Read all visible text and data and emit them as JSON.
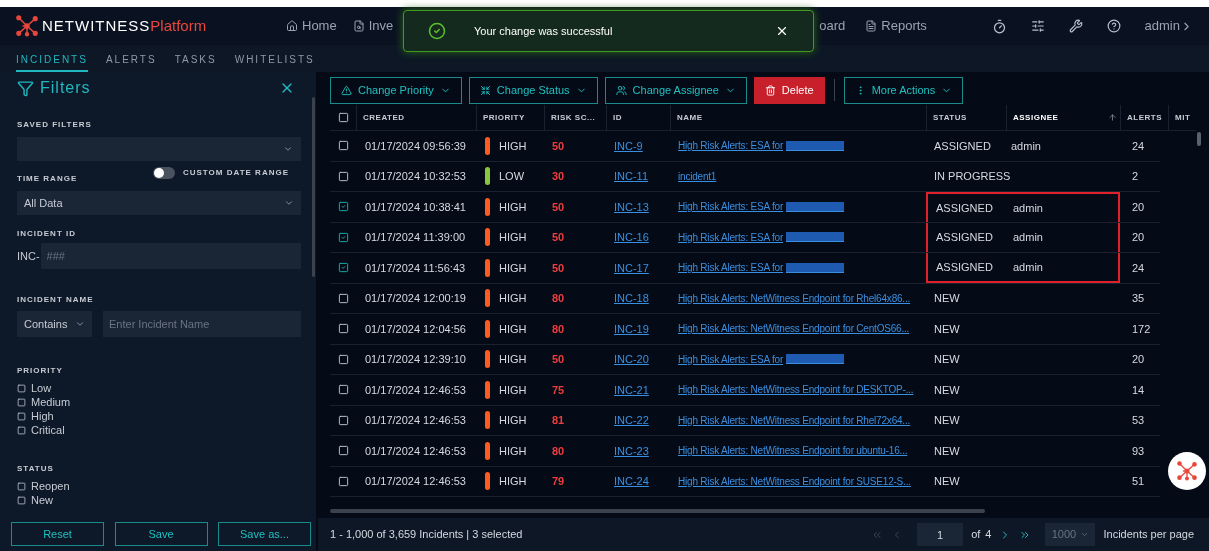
{
  "header": {
    "logo_text": "NETWITNESS",
    "logo_accent": "Platform",
    "nav": [
      {
        "label": "Home"
      },
      {
        "label": "Inve"
      },
      {
        "label": "oard"
      },
      {
        "label": "Reports"
      }
    ],
    "user": "admin"
  },
  "toast": {
    "message": "Your change was successful"
  },
  "tabs": [
    {
      "label": "INCIDENTS",
      "selected": true
    },
    {
      "label": "ALERTS",
      "selected": false
    },
    {
      "label": "TASKS",
      "selected": false
    },
    {
      "label": "WHITELISTS",
      "selected": false
    }
  ],
  "filters": {
    "title": "Filters",
    "saved_filters_label": "SAVED FILTERS",
    "custom_date_range": {
      "label": "CUSTOM DATE RANGE",
      "on": false
    },
    "time_range": {
      "label": "TIME RANGE",
      "value": "All Data"
    },
    "incident_id": {
      "label": "INCIDENT ID",
      "prefix": "INC-",
      "placeholder": "###"
    },
    "incident_name": {
      "label": "INCIDENT NAME",
      "operator": "Contains",
      "placeholder": "Enter Incident Name"
    },
    "priority": {
      "label": "PRIORITY",
      "options": [
        {
          "label": "Low",
          "checked": false
        },
        {
          "label": "Medium",
          "checked": false
        },
        {
          "label": "High",
          "checked": false
        },
        {
          "label": "Critical",
          "checked": false
        }
      ]
    },
    "status": {
      "label": "STATUS",
      "options": [
        {
          "label": "Reopen",
          "checked": false
        },
        {
          "label": "New",
          "checked": false
        }
      ]
    },
    "buttons": [
      "Reset",
      "Save",
      "Save as..."
    ]
  },
  "toolbar": [
    {
      "label": "Change Priority",
      "kind": "menu"
    },
    {
      "label": "Change Status",
      "kind": "menu"
    },
    {
      "label": "Change Assignee",
      "kind": "menu"
    },
    {
      "label": "Delete",
      "kind": "danger"
    },
    {
      "label": "More Actions",
      "kind": "more"
    }
  ],
  "table": {
    "select_all_checked": false,
    "columns": [
      {
        "label": "CREATED",
        "sorted": false
      },
      {
        "label": "PRIORITY",
        "sorted": false
      },
      {
        "label": "RISK SC...",
        "sorted": false
      },
      {
        "label": "ID",
        "sorted": false
      },
      {
        "label": "NAME",
        "sorted": false
      },
      {
        "label": "STATUS",
        "sorted": false
      },
      {
        "label": "ASSIGNEE",
        "sorted": true
      },
      {
        "label": "ALERTS",
        "sorted": false
      },
      {
        "label": "MIT",
        "sorted": false
      }
    ],
    "rows": [
      {
        "checked": false,
        "created": "01/17/2024 09:56:39",
        "priority": "HIGH",
        "color": "#ff5a1f",
        "risk": "50",
        "id": "INC-9",
        "name": "High Risk Alerts: ESA for",
        "redacted": true,
        "status": "ASSIGNED",
        "assignee": "admin",
        "alerts": "24",
        "highlighted": false
      },
      {
        "checked": false,
        "created": "01/17/2024 10:32:53",
        "priority": "LOW",
        "color": "#8cc63f",
        "risk": "30",
        "id": "INC-11",
        "name": "incident1",
        "redacted": false,
        "status": "IN PROGRESS",
        "alerts": "2",
        "highlighted": false
      },
      {
        "checked": true,
        "created": "01/17/2024 10:38:41",
        "priority": "HIGH",
        "color": "#ff5a1f",
        "risk": "50",
        "id": "INC-13",
        "name": "High Risk Alerts: ESA for",
        "redacted": true,
        "status": "ASSIGNED",
        "assignee": "admin",
        "alerts": "20",
        "highlighted": true
      },
      {
        "checked": true,
        "created": "01/17/2024 11:39:00",
        "priority": "HIGH",
        "color": "#ff5a1f",
        "risk": "50",
        "id": "INC-16",
        "name": "High Risk Alerts: ESA for",
        "redacted": true,
        "status": "ASSIGNED",
        "assignee": "admin",
        "alerts": "20",
        "highlighted": true
      },
      {
        "checked": true,
        "created": "01/17/2024 11:56:43",
        "priority": "HIGH",
        "color": "#ff5a1f",
        "risk": "50",
        "id": "INC-17",
        "name": "High Risk Alerts: ESA for",
        "redacted": true,
        "status": "ASSIGNED",
        "assignee": "admin",
        "alerts": "24",
        "highlighted": true
      },
      {
        "checked": false,
        "created": "01/17/2024 12:00:19",
        "priority": "HIGH",
        "color": "#ff5a1f",
        "risk": "80",
        "id": "INC-18",
        "name": "High Risk Alerts: NetWitness Endpoint for Rhel64x86...",
        "redacted": false,
        "status": "NEW",
        "alerts": "35",
        "highlighted": false
      },
      {
        "checked": false,
        "created": "01/17/2024 12:04:56",
        "priority": "HIGH",
        "color": "#ff5a1f",
        "risk": "80",
        "id": "INC-19",
        "name": "High Risk Alerts: NetWitness Endpoint for CentOS66...",
        "redacted": false,
        "status": "NEW",
        "alerts": "172",
        "highlighted": false
      },
      {
        "checked": false,
        "created": "01/17/2024 12:39:10",
        "priority": "HIGH",
        "color": "#ff5a1f",
        "risk": "50",
        "id": "INC-20",
        "name": "High Risk Alerts: ESA for",
        "redacted": true,
        "status": "NEW",
        "alerts": "20",
        "highlighted": false
      },
      {
        "checked": false,
        "created": "01/17/2024 12:46:53",
        "priority": "HIGH",
        "color": "#ff5a1f",
        "risk": "75",
        "id": "INC-21",
        "name": "High Risk Alerts: NetWitness Endpoint for DESKTOP-...",
        "redacted": false,
        "status": "NEW",
        "alerts": "14",
        "highlighted": false
      },
      {
        "checked": false,
        "created": "01/17/2024 12:46:53",
        "priority": "HIGH",
        "color": "#ff5a1f",
        "risk": "81",
        "id": "INC-22",
        "name": "High Risk Alerts: NetWitness Endpoint for Rhel72x64...",
        "redacted": false,
        "status": "NEW",
        "alerts": "53",
        "highlighted": false
      },
      {
        "checked": false,
        "created": "01/17/2024 12:46:53",
        "priority": "HIGH",
        "color": "#ff5a1f",
        "risk": "80",
        "id": "INC-23",
        "name": "High Risk Alerts: NetWitness Endpoint for ubuntu-16...",
        "redacted": false,
        "status": "NEW",
        "alerts": "93",
        "highlighted": false
      },
      {
        "checked": false,
        "created": "01/17/2024 12:46:53",
        "priority": "HIGH",
        "color": "#ff5a1f",
        "risk": "79",
        "id": "INC-24",
        "name": "High Risk Alerts: NetWitness Endpoint for SUSE12-S...",
        "redacted": false,
        "status": "NEW",
        "alerts": "51",
        "highlighted": false
      }
    ]
  },
  "footer": {
    "summary": "1 - 1,000 of 3,659 Incidents | 3 selected",
    "page": "1",
    "of": "of",
    "total_pages": "4",
    "page_size": "1000",
    "page_size_label": "Incidents per page"
  }
}
